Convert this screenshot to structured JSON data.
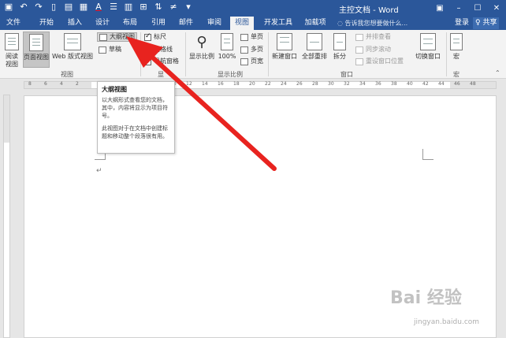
{
  "window": {
    "title": "主控文档 - Word",
    "controls": [
      "–",
      "☐",
      "✕"
    ]
  },
  "qat_icons": [
    "save-icon",
    "undo-icon",
    "redo-icon",
    "new-icon",
    "open-icon",
    "print-icon",
    "font-color-icon",
    "list-icon",
    "page-view-icon",
    "layout-icon",
    "sort-icon",
    "symbol-icon",
    "more-icon"
  ],
  "tabs": [
    {
      "label": "文件"
    },
    {
      "label": "开始"
    },
    {
      "label": "插入"
    },
    {
      "label": "设计"
    },
    {
      "label": "布局"
    },
    {
      "label": "引用"
    },
    {
      "label": "邮件"
    },
    {
      "label": "审阅"
    },
    {
      "label": "视图"
    },
    {
      "label": "开发工具"
    },
    {
      "label": "加载项"
    }
  ],
  "active_tab": "视图",
  "tell_me": "告诉我您想要做什么...",
  "account": {
    "login": "登录",
    "share": "♀ 共享"
  },
  "ribbon": {
    "views_group": {
      "label": "视图",
      "read_mode": "阅读\n视图",
      "print_layout": "页面视图",
      "web_layout": "Web 版式视图",
      "outline": "大纲视图",
      "draft": "草稿"
    },
    "show_group": {
      "label": "显",
      "ruler": "标尺",
      "gridlines": "网格线",
      "nav_pane": "导航窗格"
    },
    "zoom_group": {
      "label": "显示比例",
      "zoom": "显示比例",
      "hundred": "100%",
      "one_page": "单页",
      "multi_page": "多页",
      "page_width": "页宽"
    },
    "window_group": {
      "label": "窗口",
      "new_window": "新建窗口",
      "arrange_all": "全部重排",
      "split": "拆分",
      "side_by_side": "并排查看",
      "sync_scroll": "同步滚动",
      "reset_position": "重设窗口位置",
      "switch_windows": "切换窗口"
    },
    "macros_group": {
      "label": "宏",
      "macros": "宏"
    }
  },
  "ruler_numbers": [
    "8",
    "6",
    "4",
    "2",
    "2",
    "4",
    "6",
    "8",
    "10",
    "12",
    "14",
    "16",
    "18",
    "20",
    "22",
    "24",
    "26",
    "28",
    "30",
    "32",
    "34",
    "36",
    "38",
    "40",
    "42",
    "44",
    "46",
    "48"
  ],
  "tooltip": {
    "title": "大纲视图",
    "body1": "以大纲形式查看您的文档，其中，内容将显示为项目符号。",
    "body2": "此视图对于在文档中创建标题和移动整个段落很有用。"
  },
  "document": {
    "paragraph_mark": "↵"
  },
  "watermark": {
    "logo": "Bai 经验",
    "url": "jingyan.baidu.com"
  },
  "colors": {
    "accent": "#2b579a",
    "arrow": "#e8231f"
  }
}
